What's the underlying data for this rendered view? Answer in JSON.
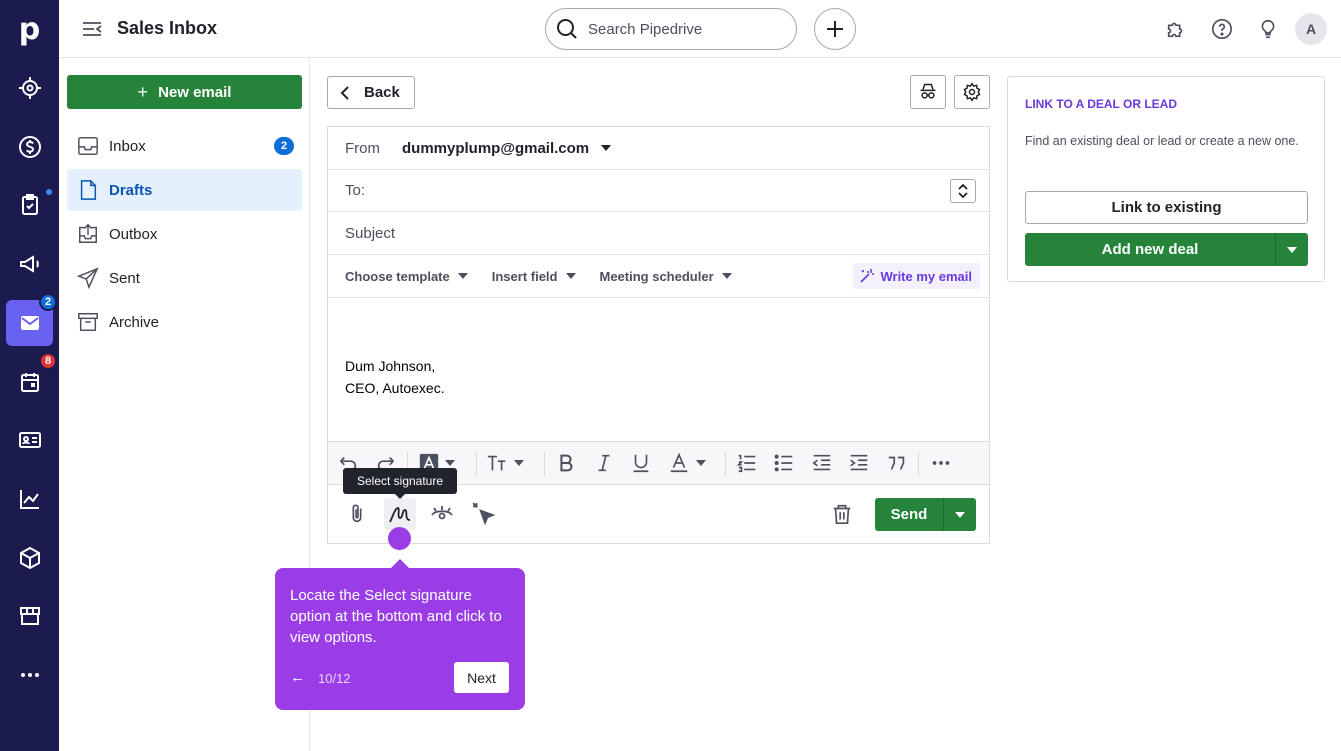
{
  "app": {
    "logo_letter": "p"
  },
  "rail": {
    "mail_badge": "2",
    "calendar_badge": "8"
  },
  "topbar": {
    "title": "Sales Inbox",
    "search_placeholder": "Search Pipedrive",
    "avatar_initial": "A"
  },
  "sidebar": {
    "new_email_label": "New email",
    "folders": [
      {
        "label": "Inbox",
        "count": "2"
      },
      {
        "label": "Drafts"
      },
      {
        "label": "Outbox"
      },
      {
        "label": "Sent"
      },
      {
        "label": "Archive"
      }
    ]
  },
  "composer": {
    "back_label": "Back",
    "from_label": "From",
    "from_value": "dummyplump@gmail.com",
    "to_label": "To:",
    "subject_placeholder": "Subject",
    "toolbar": {
      "template": "Choose template",
      "insert_field": "Insert field",
      "meeting": "Meeting scheduler",
      "write_email": "Write my email"
    },
    "body_lines": [
      "Dum Johnson,",
      "CEO, Autoexec."
    ],
    "send_label": "Send"
  },
  "tooltip": {
    "text": "Select signature"
  },
  "tour": {
    "text": "Locate the Select signature option at the bottom and click to view options.",
    "back_arrow": "←",
    "step": "10/12",
    "next_label": "Next"
  },
  "link_panel": {
    "title": "LINK TO A DEAL OR LEAD",
    "description": "Find an existing deal or lead or create a new one.",
    "link_existing": "Link to existing",
    "add_new_deal": "Add new deal"
  },
  "colors": {
    "rail_bg": "#1b1b4f",
    "rail_active": "#6861f2",
    "primary_green": "#25843a",
    "accent_purple": "#6b38dc",
    "tour_purple": "#9b3de6",
    "badge_blue": "#0d6ed9",
    "badge_red": "#e03232"
  }
}
